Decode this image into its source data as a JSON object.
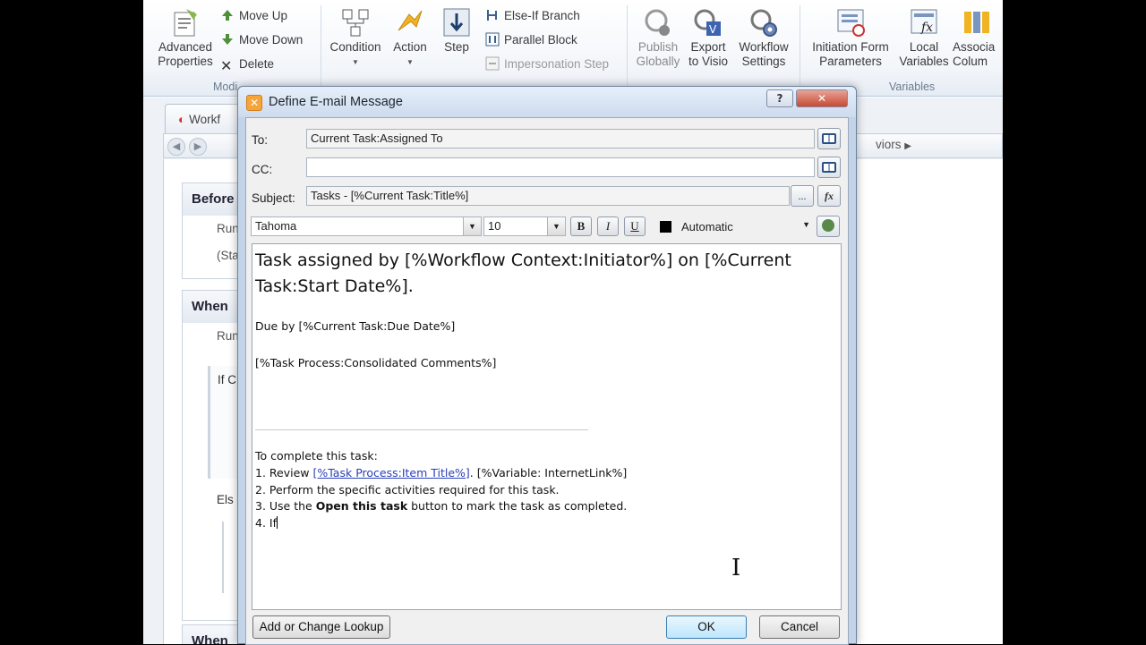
{
  "ribbon": {
    "advanced_properties": "Advanced Properties",
    "move_up": "Move Up",
    "move_down": "Move Down",
    "delete": "Delete",
    "modify_group": "Modi",
    "condition": "Condition",
    "action": "Action",
    "step": "Step",
    "else_if_branch": "Else-If Branch",
    "parallel_block": "Parallel Block",
    "impersonation_step": "Impersonation Step",
    "publish_globally": "Publish Globally",
    "export_to_visio": "Export to Visio",
    "workflow_settings": "Workflow Settings",
    "initiation_form_parameters": "Initiation Form Parameters",
    "local_variables": "Local Variables",
    "association_columns": "Associa Colum",
    "variables_group": "Variables"
  },
  "background": {
    "tab_label": "Workf",
    "breadcrumb_tail": "viors",
    "step1_header": "Before",
    "step1_line1": "Run",
    "step1_line2": "(Sta",
    "step2_header": "When",
    "step2_line1": "Run",
    "if_text": "If C",
    "else_text": "Els",
    "step3_header": "When"
  },
  "dialog": {
    "title": "Define E-mail Message",
    "help_label": "?",
    "close_label": "✕",
    "to_label": "To:",
    "to_value": "Current Task:Assigned To",
    "cc_label": "CC:",
    "cc_value": "",
    "subject_label": "Subject:",
    "subject_value": "Tasks - [%Current Task:Title%]",
    "ellipsis_label": "...",
    "fx_label": "fx",
    "font_name": "Tahoma",
    "font_size": "10",
    "bold_label": "B",
    "italic_label": "I",
    "underline_label": "U",
    "font_color": "Automatic",
    "body": {
      "heading": "Task assigned by [%Workflow Context:Initiator%] on [%Current Task:Start Date%].",
      "due": "Due by [%Current Task:Due Date%]",
      "comments": "[%Task Process:Consolidated Comments%]",
      "complete_intro": "To complete this task:",
      "step1_prefix": "1. Review ",
      "step1_link": "[%Task Process:Item Title%]",
      "step1_suffix": ". [%Variable: InternetLink%]",
      "step2": "2. Perform the specific activities required for this task.",
      "step3_prefix": "3. Use the ",
      "step3_bold": "Open this task",
      "step3_suffix": " button to mark the task as completed.",
      "step4": "4. If"
    },
    "lookup_button": "Add or Change Lookup",
    "ok_button": "OK",
    "cancel_button": "Cancel"
  },
  "colors": {
    "link": "#2a3fb8",
    "dialog_frame": "#c3d4e8",
    "close_red": "#c74a34"
  }
}
